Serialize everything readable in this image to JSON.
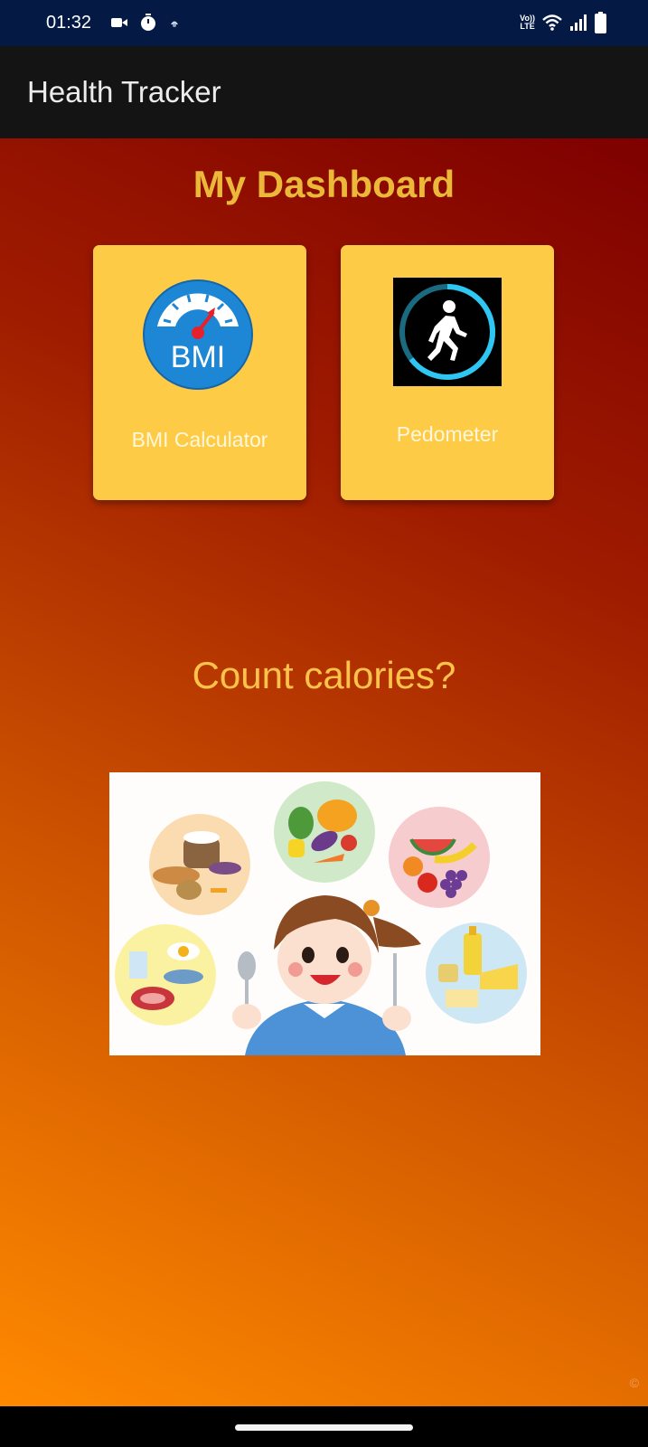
{
  "status_bar": {
    "time": "01:32",
    "network_label_top": "Vo))",
    "network_label_bottom": "LTE",
    "icons": [
      "video-record-icon",
      "timer-icon",
      "notification-icon",
      "wifi-icon",
      "signal-icon",
      "battery-icon"
    ]
  },
  "app_bar": {
    "title": "Health Tracker"
  },
  "dashboard": {
    "title": "My Dashboard",
    "cards": [
      {
        "label": "BMI Calculator",
        "icon": "bmi-gauge-icon",
        "icon_text": "BMI"
      },
      {
        "label": "Pedometer",
        "icon": "pedometer-icon"
      }
    ]
  },
  "calories": {
    "title": "Count calories?",
    "image": "kid-healthy-food-illustration"
  },
  "colors": {
    "status_bar": "#041a45",
    "app_bar": "#141414",
    "card": "#fecb47",
    "title_gold": "#ebb83a",
    "gradient_top": "#7e0000",
    "gradient_bottom": "#ff8a00"
  }
}
